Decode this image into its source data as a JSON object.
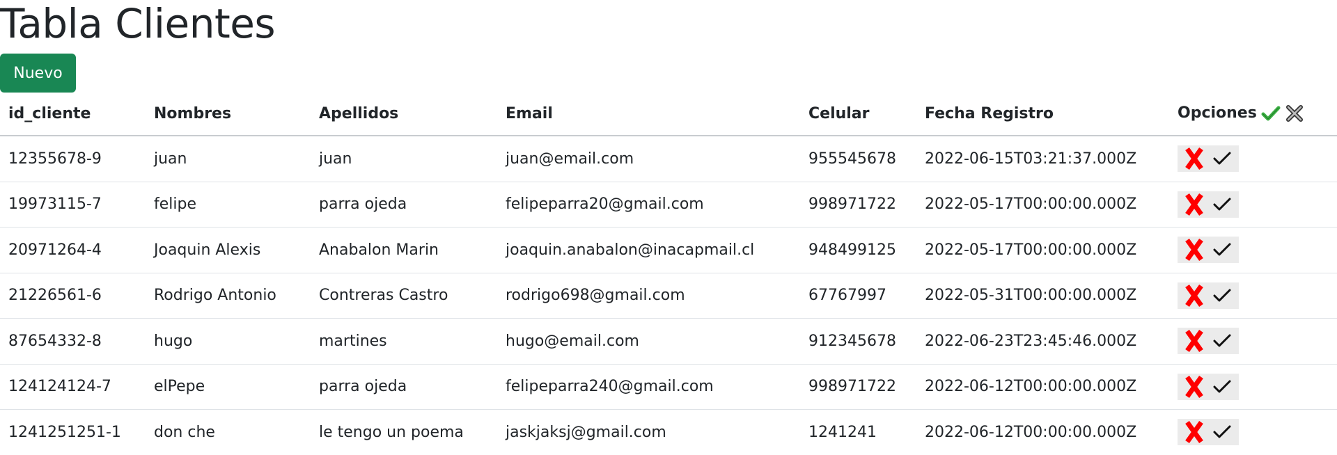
{
  "page": {
    "title": "Tabla Clientes",
    "new_button_label": "Nuevo"
  },
  "colors": {
    "new_button": "#198754",
    "delete_icon": "#ff0000",
    "confirm_icon": "#111111",
    "header_check_icon": "#3cb043"
  },
  "table": {
    "headers": {
      "id": "id_cliente",
      "nombres": "Nombres",
      "apellidos": "Apellidos",
      "email": "Email",
      "celular": "Celular",
      "fecha": "Fecha Registro",
      "opciones": "Opciones"
    },
    "header_icons": [
      "check-all-icon",
      "clear-all-icon"
    ],
    "row_icons": [
      "delete-x-icon",
      "confirm-check-icon"
    ],
    "rows": [
      {
        "id": "12355678-9",
        "nombres": "juan",
        "apellidos": "juan",
        "email": "juan@email.com",
        "celular": "955545678",
        "fecha": "2022-06-15T03:21:37.000Z"
      },
      {
        "id": "19973115-7",
        "nombres": "felipe",
        "apellidos": "parra ojeda",
        "email": "felipeparra20@gmail.com",
        "celular": "998971722",
        "fecha": "2022-05-17T00:00:00.000Z"
      },
      {
        "id": "20971264-4",
        "nombres": "Joaquin Alexis",
        "apellidos": "Anabalon Marin",
        "email": "joaquin.anabalon@inacapmail.cl",
        "celular": "948499125",
        "fecha": "2022-05-17T00:00:00.000Z"
      },
      {
        "id": "21226561-6",
        "nombres": "Rodrigo Antonio",
        "apellidos": "Contreras Castro",
        "email": "rodrigo698@gmail.com",
        "celular": "67767997",
        "fecha": "2022-05-31T00:00:00.000Z"
      },
      {
        "id": "87654332-8",
        "nombres": "hugo",
        "apellidos": "martines",
        "email": "hugo@email.com",
        "celular": "912345678",
        "fecha": "2022-06-23T23:45:46.000Z"
      },
      {
        "id": "124124124-7",
        "nombres": "elPepe",
        "apellidos": "parra ojeda",
        "email": "felipeparra240@gmail.com",
        "celular": "998971722",
        "fecha": "2022-06-12T00:00:00.000Z"
      },
      {
        "id": "1241251251-1",
        "nombres": "don che",
        "apellidos": "le tengo un poema",
        "email": "jaskjaksj@gmail.com",
        "celular": "1241241",
        "fecha": "2022-06-12T00:00:00.000Z"
      }
    ]
  }
}
